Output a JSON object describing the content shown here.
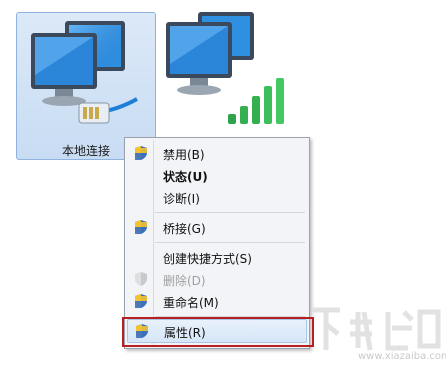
{
  "connections": [
    {
      "label": "本地连接",
      "selected": true
    },
    {
      "label": "",
      "selected": false
    }
  ],
  "context_menu": {
    "items": [
      {
        "label": "禁用(B)",
        "shield": true,
        "bold": false,
        "disabled": false
      },
      {
        "label": "状态(U)",
        "shield": false,
        "bold": true,
        "disabled": false
      },
      {
        "label": "诊断(I)",
        "shield": false,
        "bold": false,
        "disabled": false
      },
      {
        "label": "桥接(G)",
        "shield": true,
        "bold": false,
        "disabled": false
      },
      {
        "label": "创建快捷方式(S)",
        "shield": false,
        "bold": false,
        "disabled": false
      },
      {
        "label": "删除(D)",
        "shield": true,
        "bold": false,
        "disabled": true
      },
      {
        "label": "重命名(M)",
        "shield": true,
        "bold": false,
        "disabled": false
      },
      {
        "label": "属性(R)",
        "shield": true,
        "bold": false,
        "disabled": false,
        "highlighted": true
      }
    ]
  },
  "watermark": {
    "logo_text": "下载吧",
    "url": "www.xiazaiba.com"
  },
  "colors": {
    "highlight_border": "#b52020",
    "selection": "#c8dcf3"
  }
}
